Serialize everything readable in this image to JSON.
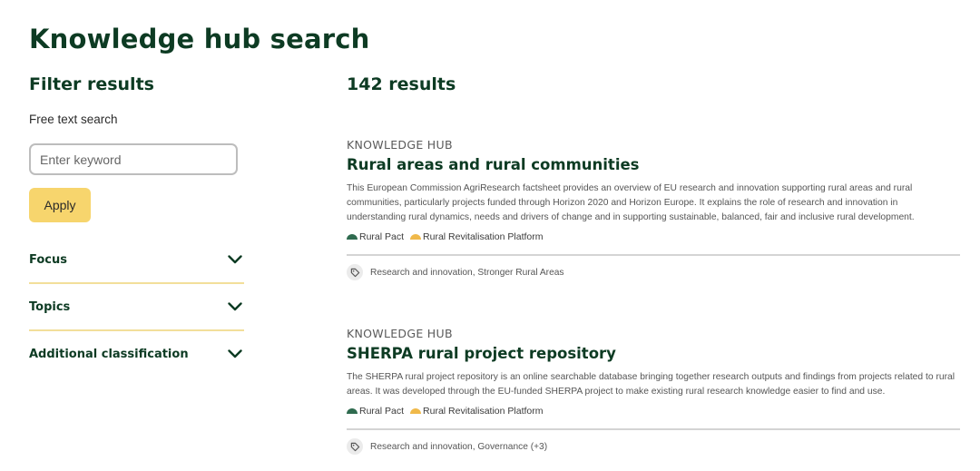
{
  "page": {
    "title": "Knowledge hub search"
  },
  "sidebar": {
    "heading": "Filter results",
    "search_label": "Free text search",
    "search_placeholder": "Enter keyword",
    "apply_label": "Apply",
    "filters": [
      {
        "label": "Focus"
      },
      {
        "label": "Topics"
      },
      {
        "label": "Additional classification"
      }
    ]
  },
  "results": {
    "count_text": "142 results",
    "items": [
      {
        "type": "KNOWLEDGE HUB",
        "title": "Rural areas and rural communities",
        "description": "This European Commission AgriResearch factsheet provides an overview of EU research and innovation supporting rural areas and rural communities, particularly projects funded through Horizon 2020 and Horizon Europe. It explains the role of research and innovation in understanding rural dynamics, needs and drivers of change and in supporting sustainable, balanced, fair and inclusive rural development.",
        "tags": [
          {
            "label": "Rural Pact",
            "color": "#2f6b4f"
          },
          {
            "label": "Rural Revitalisation Platform",
            "color": "#f0b94a"
          }
        ],
        "topics": "Research and innovation, Stronger Rural Areas"
      },
      {
        "type": "KNOWLEDGE HUB",
        "title": "SHERPA rural project repository",
        "description": "The SHERPA rural project repository is an online searchable database bringing together research outputs and findings from projects related to rural areas. It was developed through the EU-funded SHERPA project to make existing rural research knowledge easier to find and use.",
        "tags": [
          {
            "label": "Rural Pact",
            "color": "#2f6b4f"
          },
          {
            "label": "Rural Revitalisation Platform",
            "color": "#f0b94a"
          }
        ],
        "topics": "Research and innovation, Governance (+3)"
      }
    ]
  },
  "colors": {
    "heading": "#0d3b23",
    "apply_button": "#f7d56d",
    "accordion_divider": "#f2df9a"
  },
  "icons": {
    "chevron": "chevron-down-icon",
    "tag": "tag-icon"
  }
}
